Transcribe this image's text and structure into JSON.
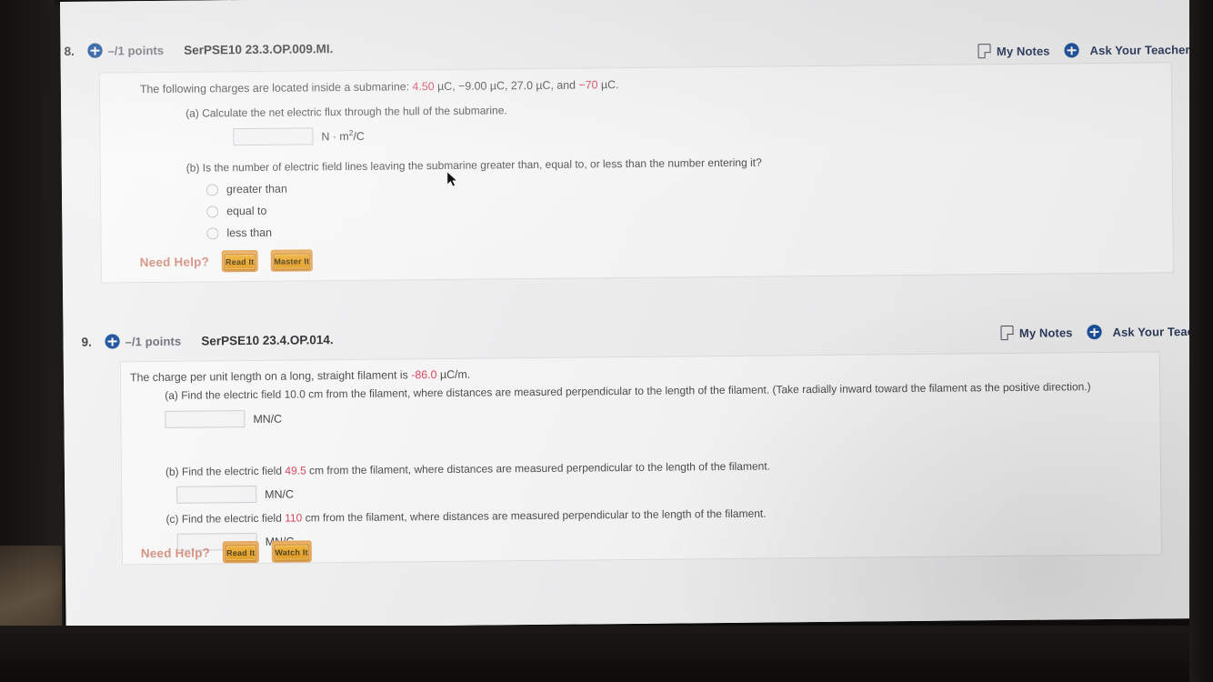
{
  "meta": {
    "accent_blue": "#17509e",
    "accent_red": "#d9425a",
    "help_orange": "#e59c1c",
    "tool_text_color": "#2b3a5c"
  },
  "questions": [
    {
      "number": "8.",
      "points": "–/1 points",
      "code": "SerPSE10 23.3.OP.009.MI.",
      "tools": {
        "notes": "My Notes",
        "ask": "Ask Your Teacher"
      },
      "prompt": {
        "lead": "The following charges are located inside a submarine: ",
        "v1": "4.50",
        "mid1": " µC, −9.00 µC, 27.0 µC, and ",
        "v2": "−70",
        "tail": " µC."
      },
      "parts": [
        {
          "label": "(a) Calculate the net electric flux through the hull of the submarine.",
          "input_value": "",
          "unit_main": "N · m",
          "unit_sup": "2",
          "unit_rest": "/C"
        },
        {
          "label": "(b) Is the number of electric field lines leaving the submarine greater than, equal to, or less than the number entering it?",
          "choices": [
            "greater than",
            "equal to",
            "less than"
          ]
        }
      ],
      "help": {
        "label": "Need Help?",
        "buttons": [
          "Read It",
          "Master It"
        ]
      }
    },
    {
      "number": "9.",
      "points": "–/1 points",
      "code": "SerPSE10 23.4.OP.014.",
      "tools": {
        "notes": "My Notes",
        "ask": "Ask Your Teacher"
      },
      "prompt": {
        "lead": "The charge per unit length on a long, straight filament is ",
        "v1": "-86.0",
        "tail": " µC/m."
      },
      "parts": [
        {
          "pre": "(a) Find the electric field ",
          "value": "10.0",
          "value_red": false,
          "post": " cm from the filament, where distances are measured perpendicular to the length of the filament. (Take radially inward toward the filament as the positive direction.)",
          "input_value": "",
          "unit": "MN/C"
        },
        {
          "pre": "(b) Find the electric field ",
          "value": "49.5",
          "value_red": true,
          "post": " cm from the filament, where distances are measured perpendicular to the length of the filament.",
          "input_value": "",
          "unit": "MN/C"
        },
        {
          "pre": "(c) Find the electric field ",
          "value": "110",
          "value_red": true,
          "post": " cm from the filament, where distances are measured perpendicular to the length of the filament.",
          "input_value": "",
          "unit": "MN/C"
        }
      ],
      "help": {
        "label": "Need Help?",
        "buttons": [
          "Read It",
          "Watch It"
        ]
      }
    }
  ]
}
